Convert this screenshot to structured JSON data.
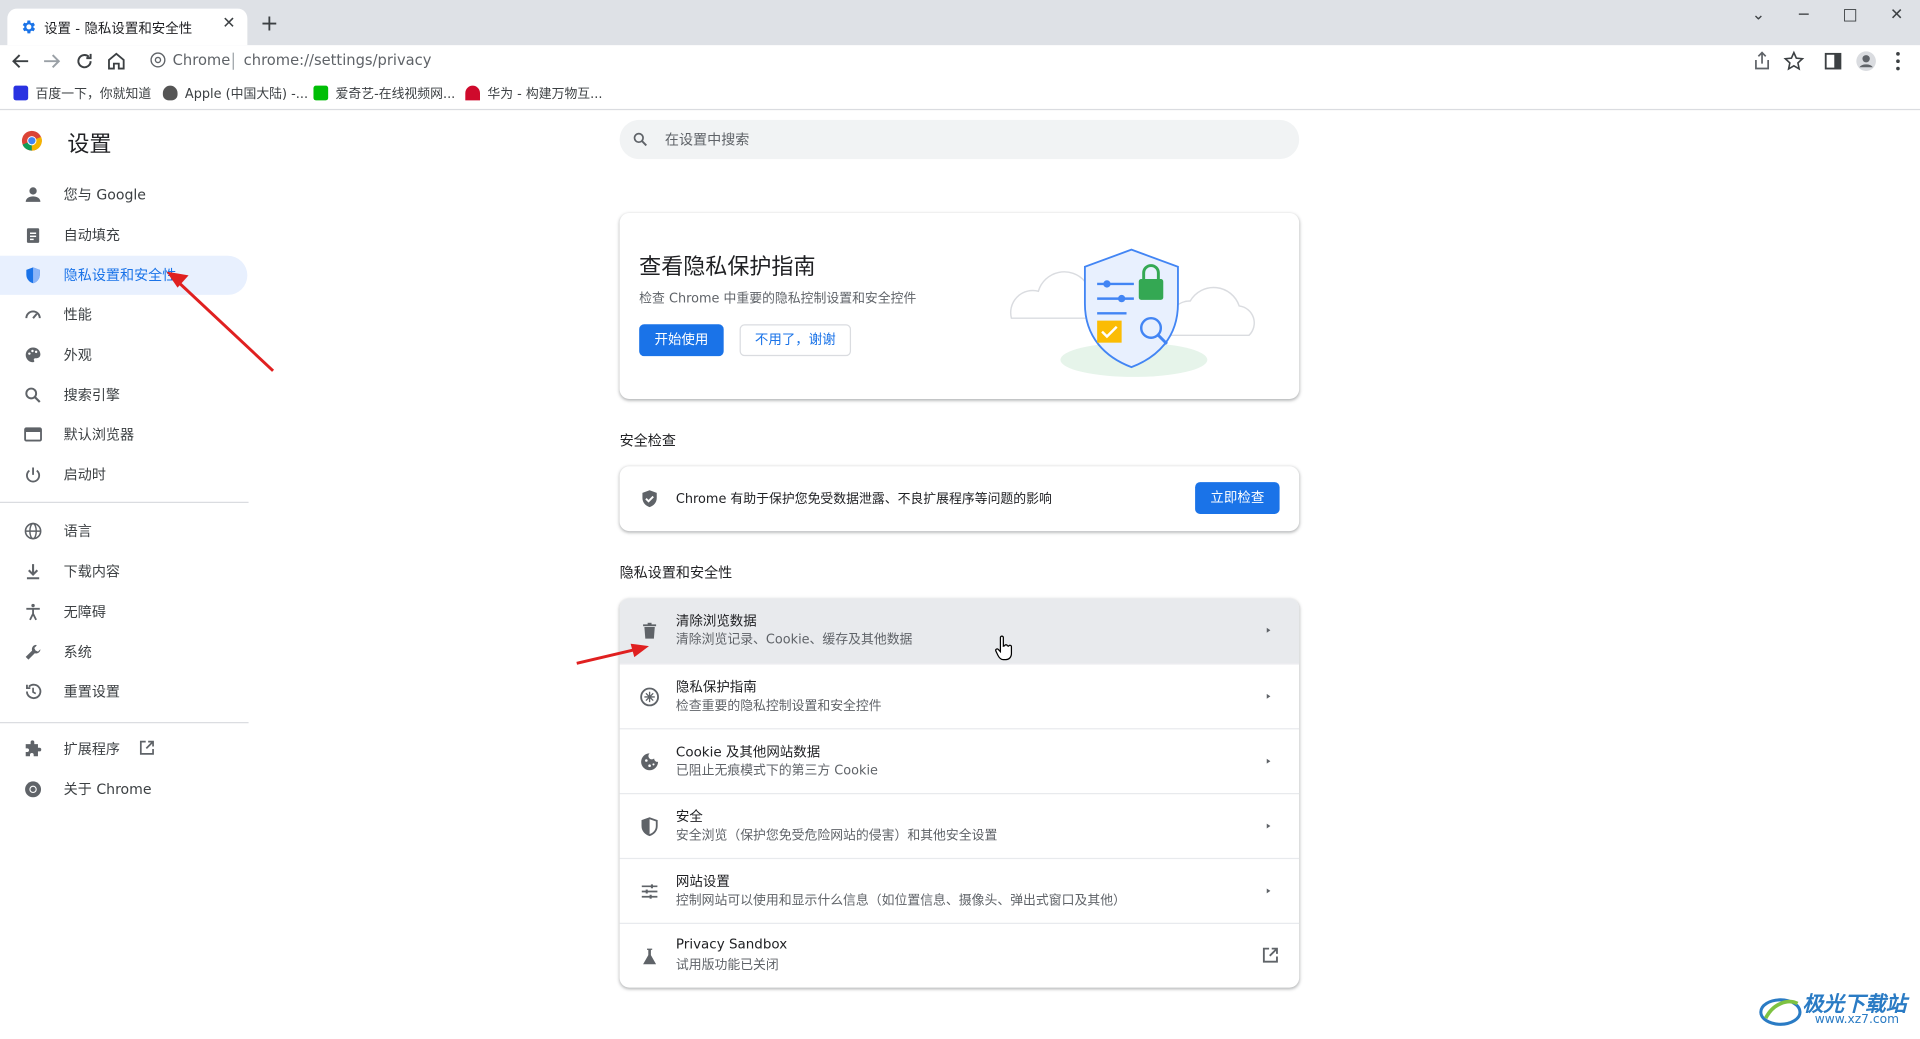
{
  "tab": {
    "title": "设置 - 隐私设置和安全性",
    "close": "✕",
    "new_tab": "+"
  },
  "window_controls": {
    "tabsearch": "⌄",
    "minimize": "─",
    "maximize": "□",
    "close": "✕"
  },
  "omnibox": {
    "site": "Chrome",
    "url": "chrome://settings/privacy"
  },
  "bookmarks": [
    {
      "label": "百度一下，你就知道",
      "color": "#2932e1"
    },
    {
      "label": "Apple (中国大陆) -...",
      "color": "#555555"
    },
    {
      "label": "爱奇艺-在线视频网...",
      "color": "#00be06"
    },
    {
      "label": "华为 - 构建万物互...",
      "color": "#cf0a2c"
    }
  ],
  "sidebar": {
    "title": "设置",
    "items": [
      {
        "label": "您与 Google",
        "icon": "person-icon"
      },
      {
        "label": "自动填充",
        "icon": "clipboard-icon"
      },
      {
        "label": "隐私设置和安全性",
        "icon": "shield-icon",
        "active": true
      },
      {
        "label": "性能",
        "icon": "speedometer-icon"
      },
      {
        "label": "外观",
        "icon": "palette-icon"
      },
      {
        "label": "搜索引擎",
        "icon": "search-icon"
      },
      {
        "label": "默认浏览器",
        "icon": "browser-icon"
      },
      {
        "label": "启动时",
        "icon": "power-icon"
      },
      {
        "label": "语言",
        "icon": "globe-icon"
      },
      {
        "label": "下载内容",
        "icon": "download-icon"
      },
      {
        "label": "无障碍",
        "icon": "accessibility-icon"
      },
      {
        "label": "系统",
        "icon": "wrench-icon"
      },
      {
        "label": "重置设置",
        "icon": "history-icon"
      },
      {
        "label": "扩展程序",
        "icon": "puzzle-icon"
      },
      {
        "label": "关于 Chrome",
        "icon": "chrome-icon"
      }
    ]
  },
  "search": {
    "placeholder": "在设置中搜索"
  },
  "privacy_guide": {
    "title": "查看隐私保护指南",
    "subtitle": "检查 Chrome 中重要的隐私控制设置和安全控件",
    "start": "开始使用",
    "dismiss": "不用了，谢谢"
  },
  "safety_check": {
    "section": "安全检查",
    "text": "Chrome 有助于保护您免受数据泄露、不良扩展程序等问题的影响",
    "button": "立即检查"
  },
  "privacy_section": {
    "title": "隐私设置和安全性",
    "rows": [
      {
        "title": "清除浏览数据",
        "sub": "清除浏览记录、Cookie、缓存及其他数据"
      },
      {
        "title": "隐私保护指南",
        "sub": "检查重要的隐私控制设置和安全控件"
      },
      {
        "title": "Cookie 及其他网站数据",
        "sub": "已阻止无痕模式下的第三方 Cookie"
      },
      {
        "title": "安全",
        "sub": "安全浏览（保护您免受危险网站的侵害）和其他安全设置"
      },
      {
        "title": "网站设置",
        "sub": "控制网站可以使用和显示什么信息（如位置信息、摄像头、弹出式窗口及其他）"
      },
      {
        "title": "Privacy Sandbox",
        "sub": "试用版功能已关闭"
      }
    ]
  },
  "watermark": {
    "text": "极光下载站",
    "url": "www.xz7.com"
  },
  "colors": {
    "accent": "#1a73e8",
    "annotation_arrow": "#e02020"
  }
}
